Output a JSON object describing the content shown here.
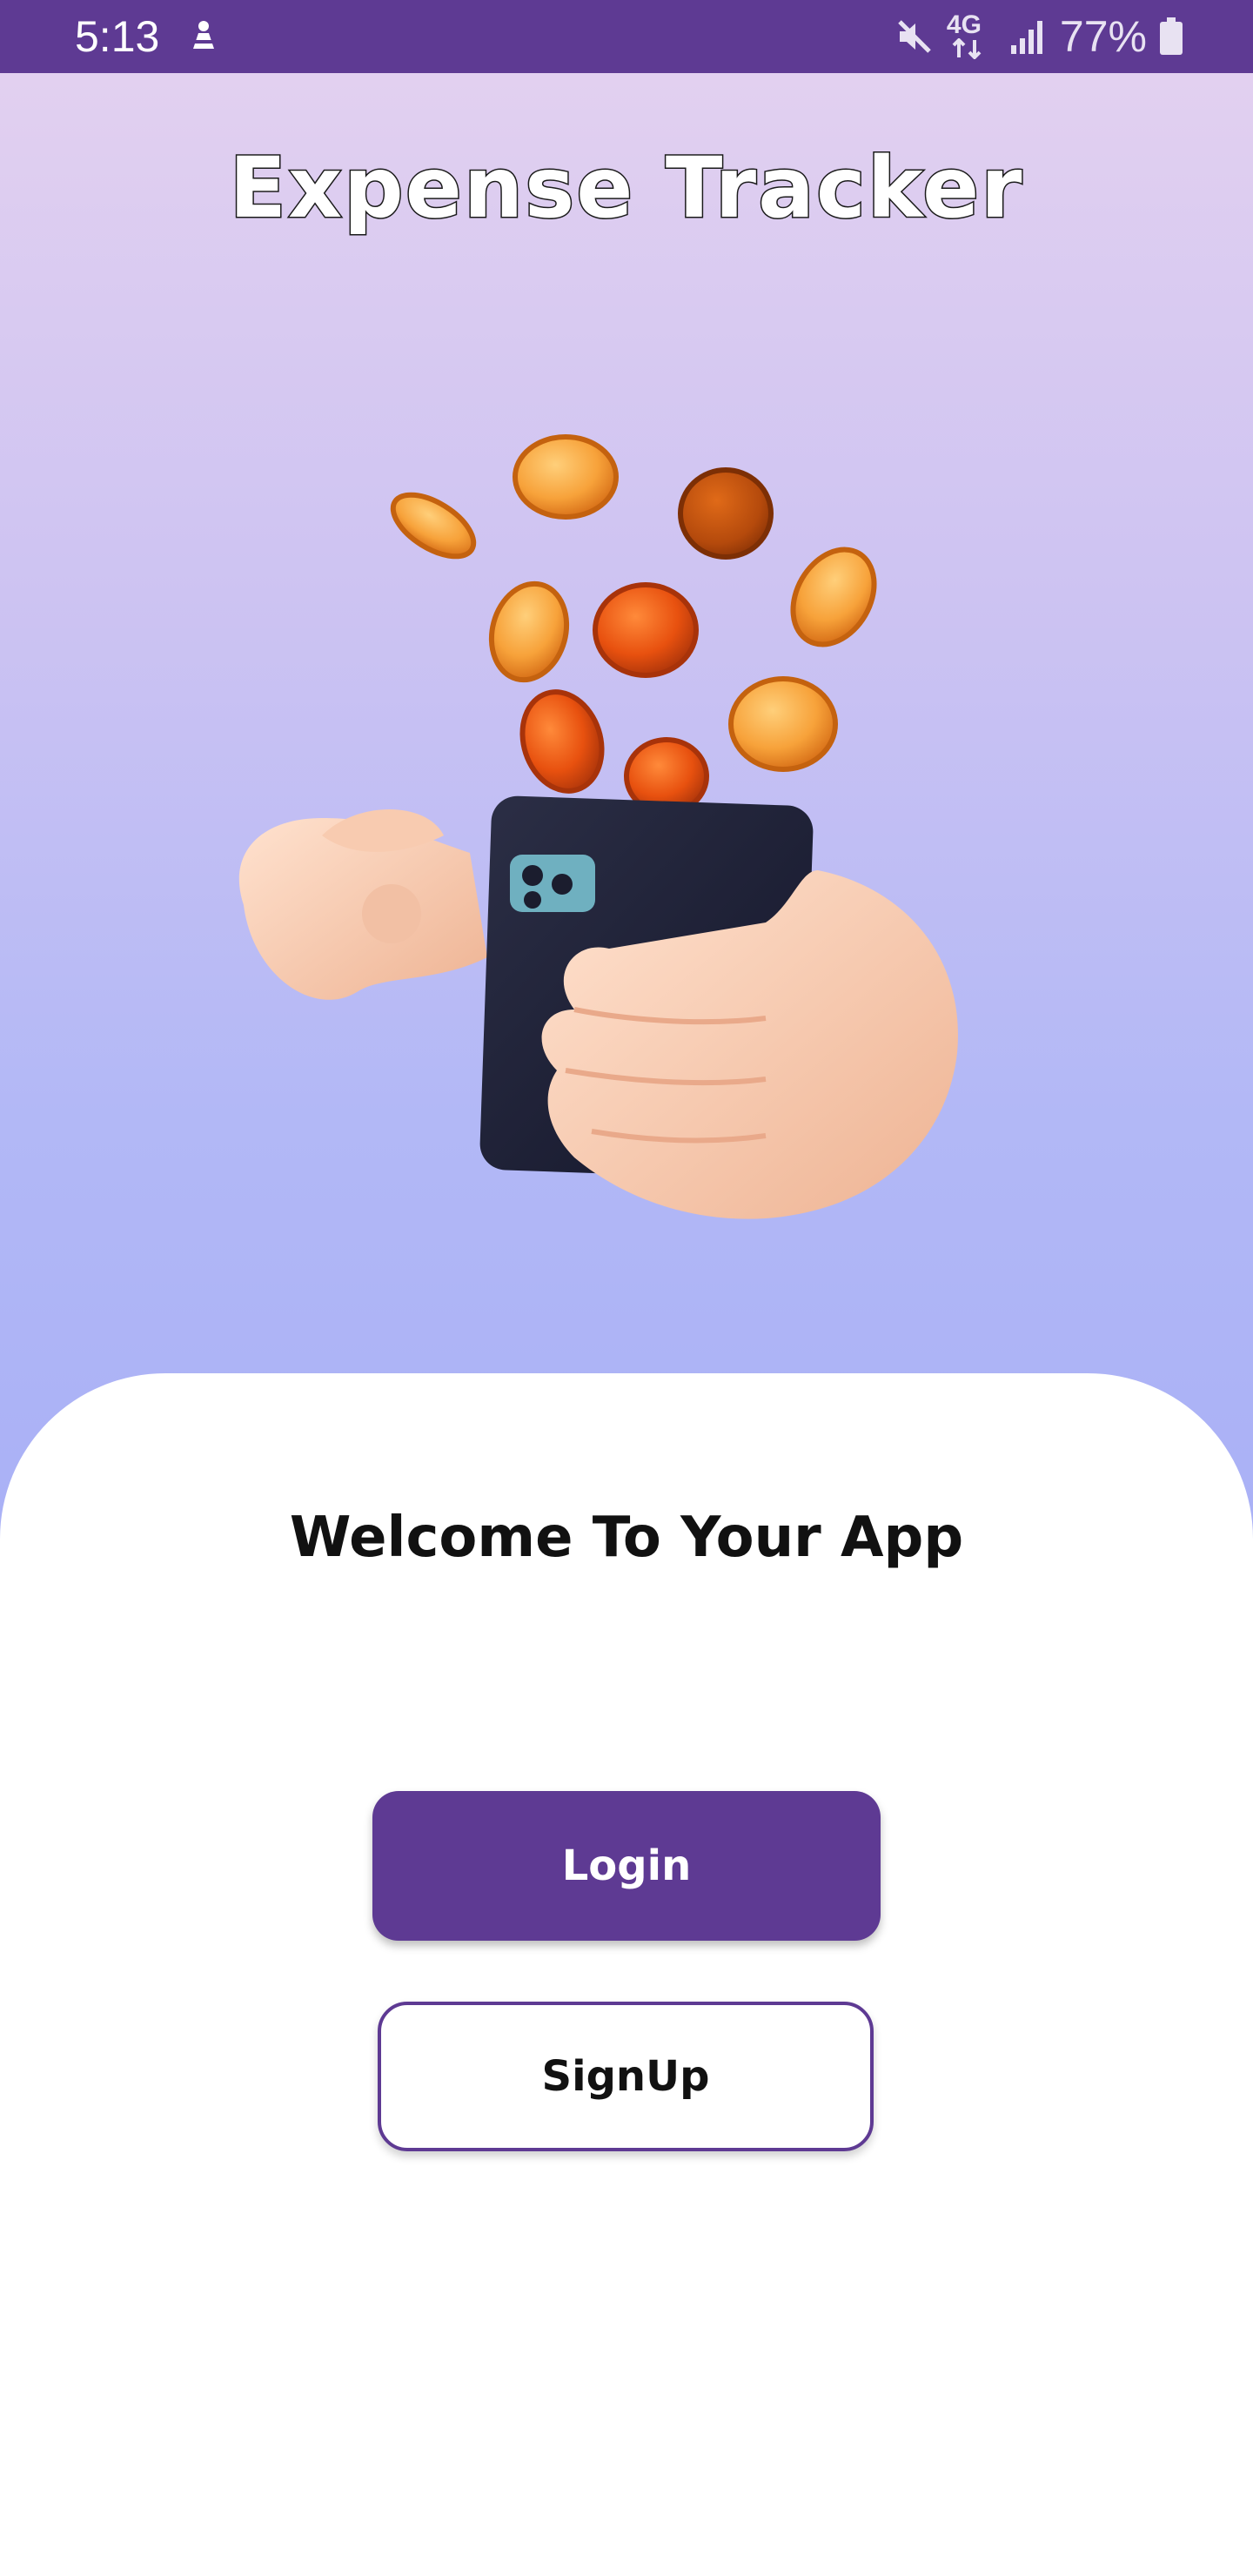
{
  "status_bar": {
    "time": "5:13",
    "network": "4G",
    "battery": "77%",
    "icons": [
      "app-notification-icon",
      "mute-icon",
      "network-4g-icon",
      "signal-icon",
      "battery-icon"
    ]
  },
  "hero": {
    "title": "Expense Tracker",
    "illustration": "hand-holding-phone-with-coins"
  },
  "welcome": {
    "heading": "Welcome To Your App"
  },
  "actions": {
    "login_label": "Login",
    "signup_label": "SignUp"
  },
  "colors": {
    "primary": "#5e3a93",
    "gradient_top": "#e2d0f0",
    "gradient_bottom": "#a9b0f6",
    "panel": "#ffffff"
  }
}
